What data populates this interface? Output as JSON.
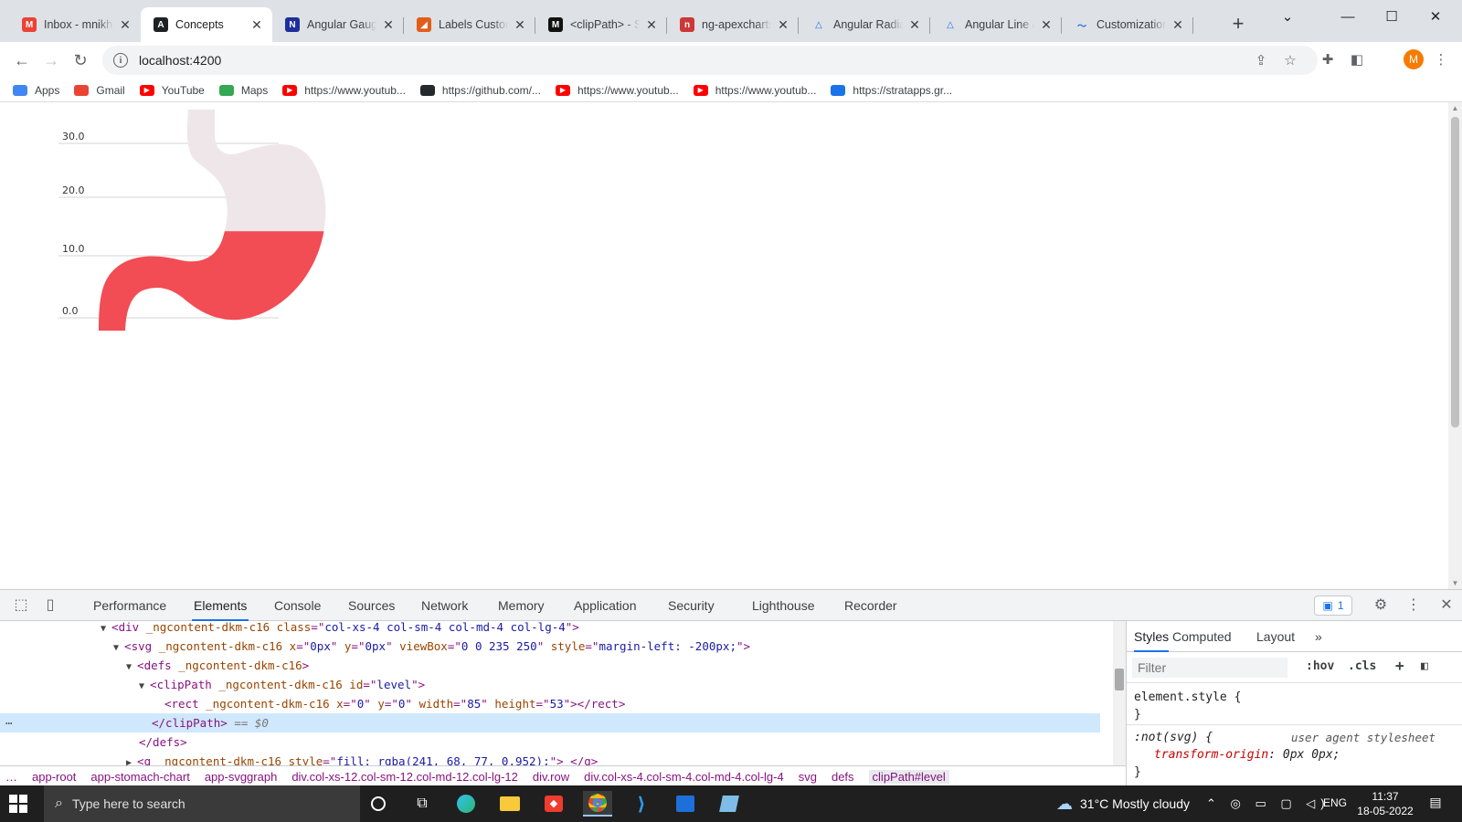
{
  "browser": {
    "tabs": [
      {
        "title": "Inbox - mnikhil",
        "favicon": "gmail-icon",
        "color": "#ea4335",
        "glyph": "M"
      },
      {
        "title": "Concepts",
        "favicon": "angular-icon",
        "color": "#202124",
        "glyph": "A",
        "active": true
      },
      {
        "title": "Angular Gauge",
        "favicon": "devexpress-icon",
        "color": "#1d2f9d",
        "glyph": "N"
      },
      {
        "title": "Labels Customiz",
        "favicon": "syncfusion-icon",
        "color": "#e35d1a",
        "glyph": "◢"
      },
      {
        "title": "<clipPath> - SV",
        "favicon": "mdn-icon",
        "color": "#111111",
        "glyph": "M"
      },
      {
        "title": "ng-apexcharts -",
        "favicon": "npm-icon",
        "color": "#cb3837",
        "glyph": "n"
      },
      {
        "title": "Angular Radialli",
        "favicon": "amcharts-icon",
        "color": "#ffffff",
        "glyph": "△"
      },
      {
        "title": "Angular Line &",
        "favicon": "amcharts-icon",
        "color": "#ffffff",
        "glyph": "△"
      },
      {
        "title": "Customization",
        "favicon": "syncfusion-icon",
        "color": "#ffffff",
        "glyph": "〜"
      }
    ],
    "url": "localhost:4200",
    "avatar_letter": "M",
    "bookmarks": [
      {
        "label": "Apps",
        "icon": "apps-grid-icon",
        "color": "#4285f4"
      },
      {
        "label": "Gmail",
        "icon": "gmail-icon",
        "color": "#ea4335"
      },
      {
        "label": "YouTube",
        "icon": "youtube-icon",
        "color": "#ff0000"
      },
      {
        "label": "Maps",
        "icon": "maps-icon",
        "color": "#34a853"
      },
      {
        "label": "https://www.youtub...",
        "icon": "youtube-icon",
        "color": "#ff0000"
      },
      {
        "label": "https://github.com/...",
        "icon": "github-icon",
        "color": "#24292e"
      },
      {
        "label": "https://www.youtub...",
        "icon": "youtube-icon",
        "color": "#ff0000"
      },
      {
        "label": "https://www.youtub...",
        "icon": "youtube-icon",
        "color": "#ff0000"
      },
      {
        "label": "https://stratapps.gr...",
        "icon": "cloud-icon",
        "color": "#1a73e8"
      }
    ]
  },
  "chart_data": {
    "type": "area",
    "title": "",
    "xlabel": "",
    "ylabel": "",
    "ylim": [
      0,
      30
    ],
    "yticks": [
      "30.0",
      "20.0",
      "10.0",
      "0.0"
    ],
    "fill_level_fraction": 0.35,
    "fill_color": "rgba(241, 68, 77, 0.952)",
    "background_color": "#efe6ea",
    "grid": true
  },
  "devtools": {
    "tabs": [
      "Performance",
      "Elements",
      "Console",
      "Sources",
      "Network",
      "Memory",
      "Application",
      "Security",
      "Lighthouse",
      "Recorder"
    ],
    "active_tab": "Elements",
    "issues_count": "1",
    "dom_lines": [
      {
        "tri": "▼",
        "parts": [
          [
            "tg",
            "<div "
          ],
          [
            "an",
            "_ngcontent-dkm-c16 class"
          ],
          [
            "tg",
            "=\""
          ],
          [
            "av",
            "col-xs-4 col-sm-4 col-md-4 col-lg-4"
          ],
          [
            "tg",
            "\">"
          ]
        ]
      },
      {
        "tri": "▼",
        "parts": [
          [
            "tg",
            "<svg "
          ],
          [
            "an",
            "_ngcontent-dkm-c16 x"
          ],
          [
            "tg",
            "=\""
          ],
          [
            "av",
            "0px"
          ],
          [
            "tg",
            "\" "
          ],
          [
            "an",
            "y"
          ],
          [
            "tg",
            "=\""
          ],
          [
            "av",
            "0px"
          ],
          [
            "tg",
            "\" "
          ],
          [
            "an",
            "viewBox"
          ],
          [
            "tg",
            "=\""
          ],
          [
            "av",
            "0 0 235 250"
          ],
          [
            "tg",
            "\" "
          ],
          [
            "an",
            "style"
          ],
          [
            "tg",
            "=\""
          ],
          [
            "av",
            "margin-left: -200px;"
          ],
          [
            "tg",
            "\">"
          ]
        ]
      },
      {
        "tri": "▼",
        "parts": [
          [
            "tg",
            "<defs "
          ],
          [
            "an",
            "_ngcontent-dkm-c16"
          ],
          [
            "tg",
            ">"
          ]
        ]
      },
      {
        "tri": "▼",
        "parts": [
          [
            "tg",
            "<clipPath "
          ],
          [
            "an",
            "_ngcontent-dkm-c16 id"
          ],
          [
            "tg",
            "=\""
          ],
          [
            "av",
            "level"
          ],
          [
            "tg",
            "\">"
          ]
        ]
      },
      {
        "tri": "",
        "parts": [
          [
            "tg",
            "<rect "
          ],
          [
            "an",
            "_ngcontent-dkm-c16 x"
          ],
          [
            "tg",
            "=\""
          ],
          [
            "av",
            "0"
          ],
          [
            "tg",
            "\" "
          ],
          [
            "an",
            "y"
          ],
          [
            "tg",
            "=\""
          ],
          [
            "av",
            "0"
          ],
          [
            "tg",
            "\" "
          ],
          [
            "an",
            "width"
          ],
          [
            "tg",
            "=\""
          ],
          [
            "av",
            "85"
          ],
          [
            "tg",
            "\" "
          ],
          [
            "an",
            "height"
          ],
          [
            "tg",
            "=\""
          ],
          [
            "av",
            "53"
          ],
          [
            "tg",
            "\"></rect>"
          ]
        ]
      },
      {
        "tri": "",
        "parts": [
          [
            "tg",
            "</clipPath>"
          ],
          [
            "dim",
            " == $0"
          ]
        ],
        "selected": true
      },
      {
        "tri": "",
        "parts": [
          [
            "tg",
            "</defs>"
          ]
        ]
      },
      {
        "tri": "▶",
        "parts": [
          [
            "tg",
            "<g "
          ],
          [
            "an",
            "_ngcontent-dkm-c16 style"
          ],
          [
            "tg",
            "=\""
          ],
          [
            "av",
            "fill: rgba(241, 68, 77, 0.952);"
          ],
          [
            "tg",
            "\"> </g>"
          ]
        ]
      }
    ],
    "breadcrumbs": [
      "app-root",
      "app-stomach-chart",
      "app-svggraph",
      "div.col-xs-12.col-sm-12.col-md-12.col-lg-12",
      "div.row",
      "div.col-xs-4.col-sm-4.col-md-4.col-lg-4",
      "svg",
      "defs",
      "clipPath#level"
    ],
    "styles_tabs": [
      "Styles",
      "Computed",
      "Layout"
    ],
    "filter_placeholder": "Filter",
    "hov_label": ":hov",
    "cls_label": ".cls",
    "css_rules": {
      "element_selector": "element.style {",
      "close": "}",
      "rule2_selector": ":not(svg) {",
      "rule2_source": "user agent stylesheet",
      "rule2_prop": "transform-origin",
      "rule2_value": ": 0px 0px;"
    }
  },
  "taskbar": {
    "search_placeholder": "Type here to search",
    "weather": "31°C  Mostly cloudy",
    "language": "ENG",
    "time": "11:37",
    "date": "18-05-2022",
    "notification_count": "1"
  }
}
